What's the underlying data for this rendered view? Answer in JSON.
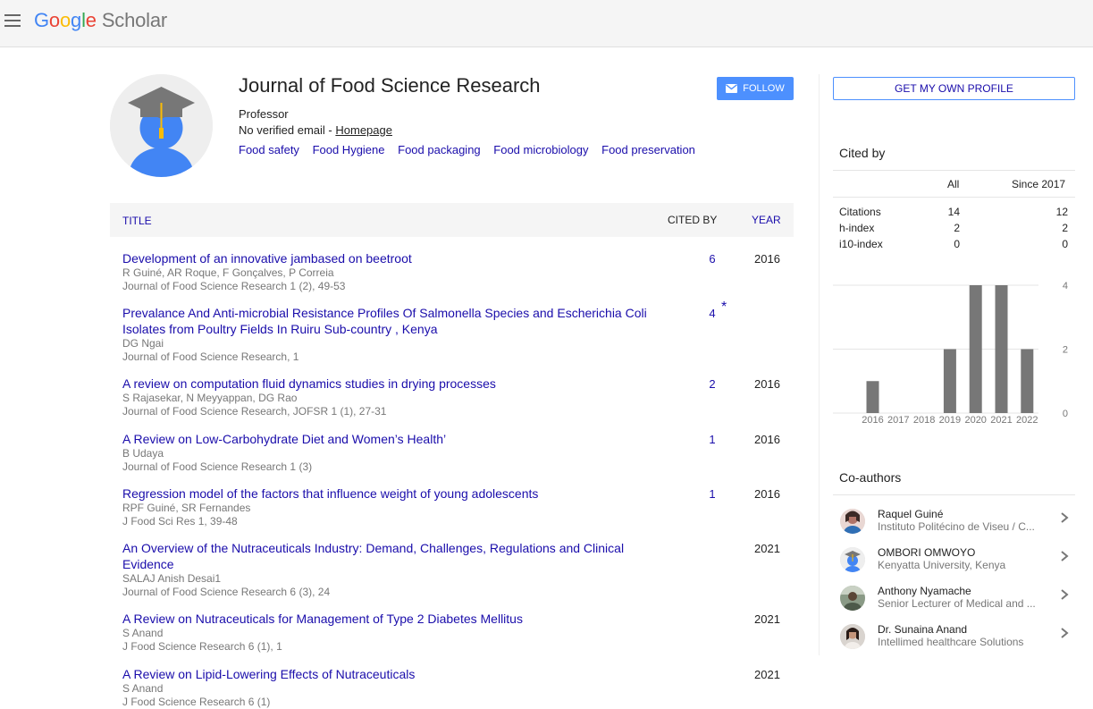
{
  "header": {
    "logo": {
      "G": "G",
      "o1": "o",
      "o2": "o",
      "g": "g",
      "l": "l",
      "e": "e",
      "scholar": "Scholar"
    }
  },
  "profile": {
    "name": "Journal of Food Science Research",
    "role": "Professor",
    "email_text": "No verified email - ",
    "homepage_label": "Homepage",
    "interests": [
      "Food safety",
      "Food Hygiene",
      "Food packaging",
      "Food microbiology",
      "Food preservation"
    ],
    "follow_label": "FOLLOW",
    "get_profile_label": "GET MY OWN PROFILE"
  },
  "table": {
    "col_title": "TITLE",
    "col_cited": "CITED BY",
    "col_year": "YEAR"
  },
  "articles": [
    {
      "title": "Development of an innovative jambased on beetroot",
      "authors": "R Guiné, AR Roque, F Gonçalves, P Correia",
      "source": "Journal of Food Science Research 1 (2), 49-53",
      "cited": "6",
      "year": "2016",
      "star": ""
    },
    {
      "title": "Prevalance And Anti-microbial Resistance Profiles Of Salmonella Species and Escherichia Coli Isolates from Poultry Fields In Ruiru Sub-country , Kenya",
      "authors": "DG Ngai",
      "source": "Journal of Food Science Research, 1",
      "cited": "4",
      "year": "",
      "star": "*"
    },
    {
      "title": "A review on computation fluid dynamics studies in drying processes",
      "authors": "S Rajasekar, N Meyyappan, DG Rao",
      "source": "Journal of Food Science Research, JOFSR 1 (1), 27-31",
      "cited": "2",
      "year": "2016",
      "star": ""
    },
    {
      "title": "A Review on Low-Carbohydrate Diet and Women’s Health’",
      "authors": "B Udaya",
      "source": "Journal of Food Science Research 1 (3)",
      "cited": "1",
      "year": "2016",
      "star": ""
    },
    {
      "title": "Regression model of the factors that influence weight of young adolescents",
      "authors": "RPF Guiné, SR Fernandes",
      "source": "J Food Sci Res 1, 39-48",
      "cited": "1",
      "year": "2016",
      "star": ""
    },
    {
      "title": "An Overview of the Nutraceuticals Industry: Demand, Challenges, Regulations and Clinical Evidence",
      "authors": "SALAJ Anish Desai1",
      "source": "Journal of Food Science Research 6 (3), 24",
      "cited": "",
      "year": "2021",
      "star": ""
    },
    {
      "title": "A Review on Nutraceuticals for Management of Type 2 Diabetes Mellitus",
      "authors": "S Anand",
      "source": "J Food Science Research 6 (1), 1",
      "cited": "",
      "year": "2021",
      "star": ""
    },
    {
      "title": "A Review on Lipid-Lowering Effects of Nutraceuticals",
      "authors": "S Anand",
      "source": "J Food Science Research 6 (1)",
      "cited": "",
      "year": "2021",
      "star": ""
    }
  ],
  "cited_by": {
    "title": "Cited by",
    "col_all": "All",
    "col_since": "Since 2017",
    "rows": [
      {
        "label": "Citations",
        "all": "14",
        "since": "12"
      },
      {
        "label": "h-index",
        "all": "2",
        "since": "2"
      },
      {
        "label": "i10-index",
        "all": "0",
        "since": "0"
      }
    ]
  },
  "chart_data": {
    "type": "bar",
    "categories": [
      "2016",
      "2017",
      "2018",
      "2019",
      "2020",
      "2021",
      "2022"
    ],
    "values": [
      1,
      0,
      0,
      2,
      4,
      4,
      2
    ],
    "title": "",
    "xlabel": "",
    "ylabel": "",
    "ylim": [
      0,
      4
    ],
    "yticks": [
      "4",
      "2",
      "0"
    ],
    "grid": true,
    "bar_color": "#777777"
  },
  "coauthors": {
    "title": "Co-authors",
    "items": [
      {
        "name": "Raquel Guiné",
        "affiliation": "Instituto Politécino de Viseu / C..."
      },
      {
        "name": "OMBORI OMWOYO",
        "affiliation": "Kenyatta University, Kenya"
      },
      {
        "name": "Anthony Nyamache",
        "affiliation": "Senior Lecturer of Medical and ..."
      },
      {
        "name": "Dr. Sunaina Anand",
        "affiliation": "Intellimed healthcare Solutions"
      }
    ]
  },
  "colors": {
    "link": "#1a0dab",
    "accent": "#4d90fe",
    "muted": "#777777"
  }
}
